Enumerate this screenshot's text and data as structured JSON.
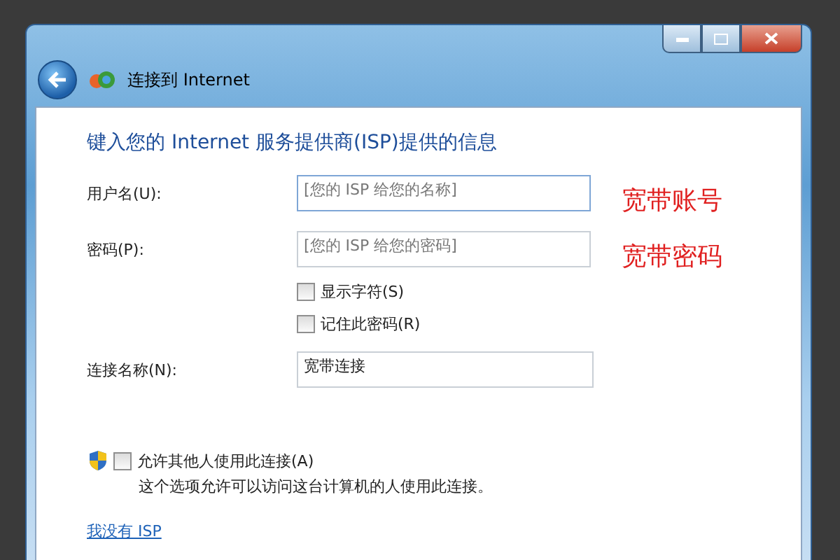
{
  "window": {
    "title": "连接到 Internet"
  },
  "heading": "键入您的 Internet 服务提供商(ISP)提供的信息",
  "fields": [
    {
      "label": "用户名(U):",
      "placeholder": "[您的 ISP 给您的名称]",
      "focused": true,
      "annotation": "宽带账号"
    },
    {
      "label": "密码(P):",
      "placeholder": "[您的 ISP 给您的密码]",
      "focused": false,
      "annotation": "宽带密码"
    }
  ],
  "options": [
    {
      "label": "显示字符(S)",
      "checked": false
    },
    {
      "label": "记住此密码(R)",
      "checked": false
    }
  ],
  "connection_name": {
    "label": "连接名称(N):",
    "value": "宽带连接"
  },
  "share": {
    "label": "允许其他人使用此连接(A)",
    "checked": false,
    "description": "这个选项允许可以访问这台计算机的人使用此连接。"
  },
  "link": "我没有 ISP"
}
